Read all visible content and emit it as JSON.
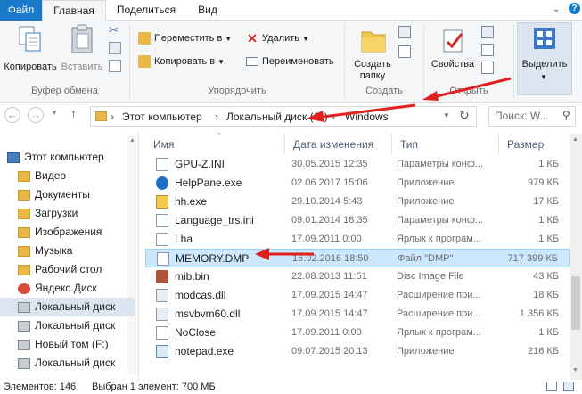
{
  "tabs": {
    "file": "Файл",
    "home": "Главная",
    "share": "Поделиться",
    "view": "Вид"
  },
  "ribbon": {
    "clipboard": {
      "copy": "Копировать",
      "paste": "Вставить",
      "group": "Буфер обмена"
    },
    "organize": {
      "move_to": "Переместить в",
      "copy_to": "Копировать в",
      "delete": "Удалить",
      "rename": "Переименовать",
      "group": "Упорядочить"
    },
    "new": {
      "new_folder_line1": "Создать",
      "new_folder_line2": "папку",
      "group": "Создать"
    },
    "open": {
      "properties": "Свойства",
      "group": "Открыть"
    },
    "select": {
      "select_label": "Выделить"
    }
  },
  "address": {
    "crumbs": [
      "Этот компьютер",
      "Локальный диск (C:)",
      "Windows"
    ],
    "search_placeholder": "Поиск: W..."
  },
  "nav": [
    {
      "label": "Этот компьютер",
      "icon": "computer-icon"
    },
    {
      "label": "Видео",
      "icon": "folder-icon"
    },
    {
      "label": "Документы",
      "icon": "folder-icon"
    },
    {
      "label": "Загрузки",
      "icon": "folder-icon"
    },
    {
      "label": "Изображения",
      "icon": "folder-icon"
    },
    {
      "label": "Музыка",
      "icon": "folder-icon"
    },
    {
      "label": "Рабочий стол",
      "icon": "folder-icon"
    },
    {
      "label": "Яндекс.Диск",
      "icon": "cloud-icon"
    },
    {
      "label": "Локальный диск",
      "icon": "drive-icon"
    },
    {
      "label": "Локальный диск",
      "icon": "drive-icon"
    },
    {
      "label": "Новый том (F:)",
      "icon": "drive-icon"
    },
    {
      "label": "Локальный диск",
      "icon": "drive-icon"
    }
  ],
  "columns": {
    "name": "Имя",
    "date": "Дата изменения",
    "type": "Тип",
    "size": "Размер"
  },
  "files": [
    {
      "name": "GPU-Z.INI",
      "date": "30.05.2015 12:35",
      "type": "Параметры конф...",
      "size": "1 КБ"
    },
    {
      "name": "HelpPane.exe",
      "date": "02.06.2017 15:06",
      "type": "Приложение",
      "size": "979 КБ"
    },
    {
      "name": "hh.exe",
      "date": "29.10.2014 5:43",
      "type": "Приложение",
      "size": "17 КБ"
    },
    {
      "name": "Language_trs.ini",
      "date": "09.01.2014 18:35",
      "type": "Параметры конф...",
      "size": "1 КБ"
    },
    {
      "name": "Lha",
      "date": "17.09.2011 0:00",
      "type": "Ярлык к програм...",
      "size": "1 КБ"
    },
    {
      "name": "MEMORY.DMP",
      "date": "16.02.2016 18:50",
      "type": "Файл \"DMP\"",
      "size": "717 399 КБ"
    },
    {
      "name": "mib.bin",
      "date": "22.08.2013 11:51",
      "type": "Disc Image File",
      "size": "43 КБ"
    },
    {
      "name": "modcas.dll",
      "date": "17.09.2015 14:47",
      "type": "Расширение при...",
      "size": "18 КБ"
    },
    {
      "name": "msvbvm60.dll",
      "date": "17.09.2015 14:47",
      "type": "Расширение при...",
      "size": "1 356 КБ"
    },
    {
      "name": "NoClose",
      "date": "17.09.2011 0:00",
      "type": "Ярлык к програм...",
      "size": "1 КБ"
    },
    {
      "name": "notepad.exe",
      "date": "09.07.2015 20:13",
      "type": "Приложение",
      "size": "216 КБ"
    }
  ],
  "status": {
    "count": "Элементов: 146",
    "selected": "Выбран 1 элемент: 700 МБ"
  },
  "colors": {
    "accent": "#1979ca",
    "selection": "#cce8ff",
    "arrow": "#e0201f"
  }
}
